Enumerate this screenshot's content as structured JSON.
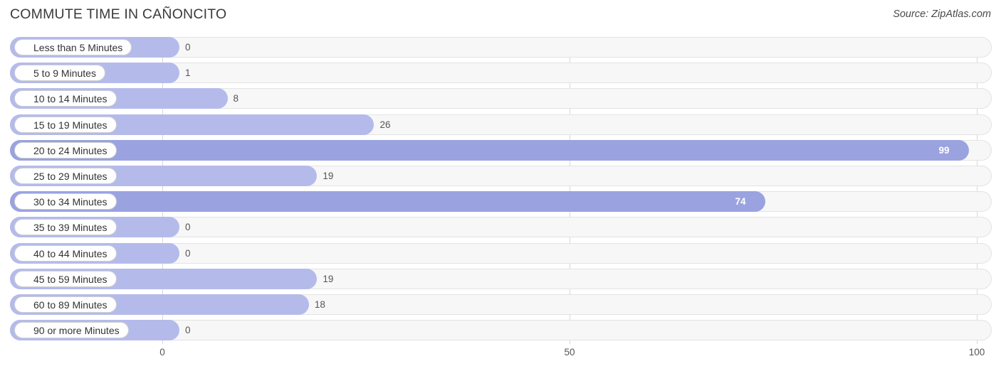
{
  "header": {
    "title": "COMMUTE TIME IN CAÑONCITO",
    "source": "Source: ZipAtlas.com"
  },
  "chart_data": {
    "type": "bar",
    "orientation": "horizontal",
    "title": "COMMUTE TIME IN CAÑONCITO",
    "xlabel": "",
    "ylabel": "",
    "xlim": [
      0,
      100
    ],
    "ticks": [
      "0",
      "50",
      "100"
    ],
    "tick_values": [
      0,
      50,
      100
    ],
    "grid": true,
    "legend": false,
    "categories": [
      "Less than 5 Minutes",
      "5 to 9 Minutes",
      "10 to 14 Minutes",
      "15 to 19 Minutes",
      "20 to 24 Minutes",
      "25 to 29 Minutes",
      "30 to 34 Minutes",
      "35 to 39 Minutes",
      "40 to 44 Minutes",
      "45 to 59 Minutes",
      "60 to 89 Minutes",
      "90 or more Minutes"
    ],
    "values": [
      0,
      1,
      8,
      26,
      99,
      19,
      74,
      0,
      0,
      19,
      18,
      0
    ],
    "value_labels": [
      "0",
      "1",
      "8",
      "26",
      "99",
      "19",
      "74",
      "0",
      "0",
      "19",
      "18",
      "0"
    ]
  },
  "colors": {
    "bar": "#9aa3e0",
    "bar_light": "#b4bbeb",
    "track": "#f7f7f7",
    "grid": "#d8d8d8",
    "title": "#3a3a3a"
  }
}
